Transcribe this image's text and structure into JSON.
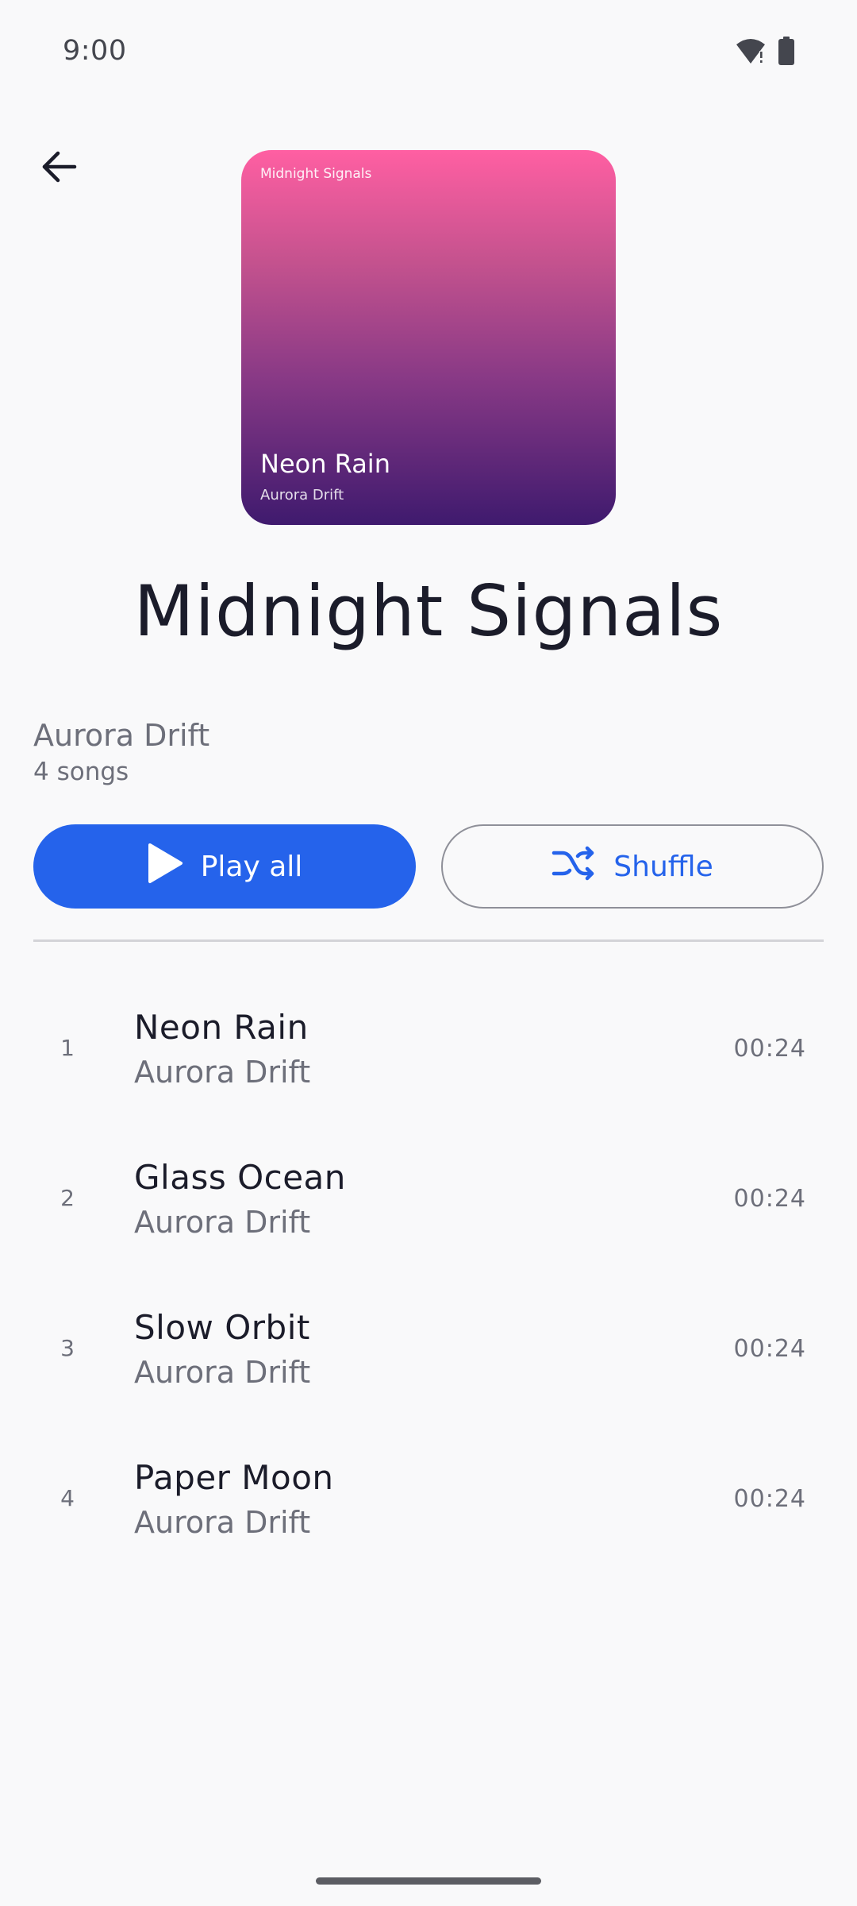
{
  "status_bar": {
    "time": "9:00"
  },
  "album": {
    "art_top_title": "Midnight Signals",
    "art_song_title": "Neon Rain",
    "art_artist": "Aurora Drift",
    "title": "Midnight Signals",
    "artist": "Aurora Drift",
    "song_count": "4 songs"
  },
  "actions": {
    "play_all_label": "Play all",
    "shuffle_label": "Shuffle"
  },
  "tracks": [
    {
      "number": "1",
      "title": "Neon Rain",
      "artist": "Aurora Drift",
      "duration": "00:24"
    },
    {
      "number": "2",
      "title": "Glass Ocean",
      "artist": "Aurora Drift",
      "duration": "00:24"
    },
    {
      "number": "3",
      "title": "Slow Orbit",
      "artist": "Aurora Drift",
      "duration": "00:24"
    },
    {
      "number": "4",
      "title": "Paper Moon",
      "artist": "Aurora Drift",
      "duration": "00:24"
    }
  ],
  "colors": {
    "accent": "#2563eb",
    "background": "#f9f9fa",
    "art_gradient_top": "#ff5fa2",
    "art_gradient_bottom": "#3f1a6e"
  },
  "icons": {
    "back": "arrow-back-icon",
    "wifi": "wifi-alert-icon",
    "battery": "battery-icon",
    "play": "play-icon",
    "shuffle": "shuffle-icon"
  }
}
